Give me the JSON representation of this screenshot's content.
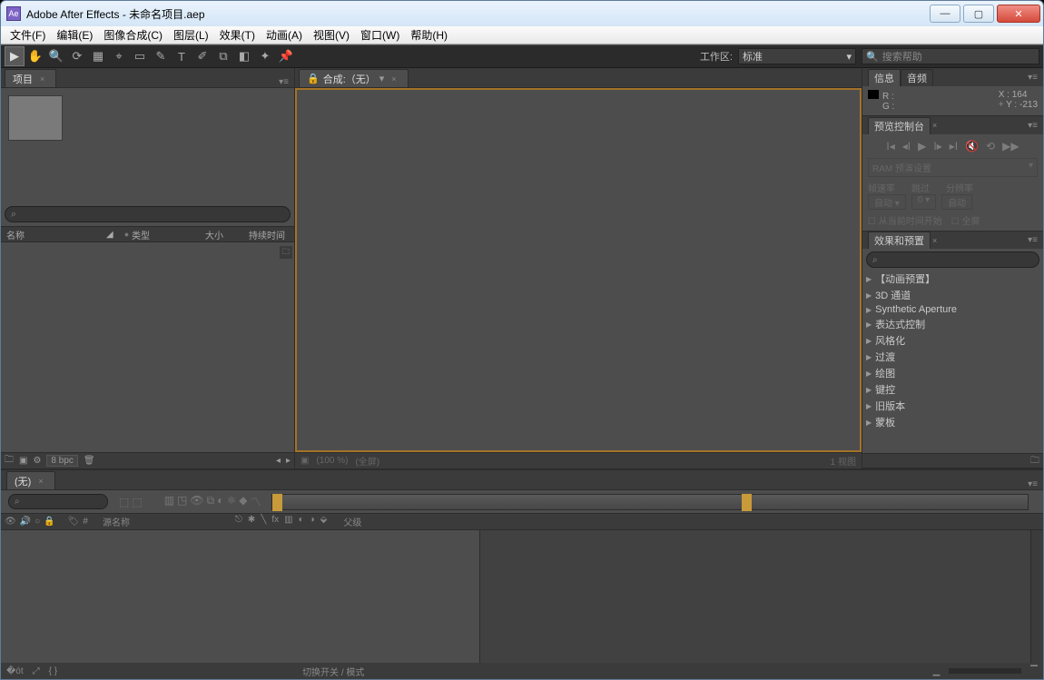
{
  "title": "Adobe After Effects - 未命名项目.aep",
  "menus": [
    "文件(F)",
    "编辑(E)",
    "图像合成(C)",
    "图层(L)",
    "效果(T)",
    "动画(A)",
    "视图(V)",
    "窗口(W)",
    "帮助(H)"
  ],
  "toolbar": {
    "workspace_label": "工作区:",
    "workspace_value": "标准",
    "search_placeholder": "搜索帮助"
  },
  "project": {
    "tab": "项目",
    "columns": {
      "name": "名称",
      "label_hdr": "",
      "type": "类型",
      "size": "大小",
      "duration": "持续时间"
    },
    "footer": {
      "bpc": "8 bpc"
    }
  },
  "composition": {
    "tab": "合成:（无）",
    "footer": {
      "zoom": "(100 %)",
      "res": "(全屏)",
      "view": "1 视图"
    }
  },
  "info": {
    "tab_info": "信息",
    "tab_audio": "音频",
    "r": "R :",
    "g": "G :",
    "x_lbl": "X :",
    "x_val": "164",
    "y_lbl": "Y :",
    "y_val": "-213"
  },
  "preview": {
    "title": "预览控制台",
    "ram": "RAM 预演设置",
    "rate": "帧速率",
    "skip": "跳过",
    "res": "分辨率",
    "auto": "自动",
    "from": "从当前时间开始",
    "full": "全屏"
  },
  "effects": {
    "title": "效果和预置",
    "items": [
      "【动画预置】",
      "3D 通道",
      "Synthetic Aperture",
      "表达式控制",
      "风格化",
      "过渡",
      "绘图",
      "键控",
      "旧版本",
      "蒙板"
    ]
  },
  "timeline": {
    "tab": "(无)",
    "name_col": "源名称",
    "parent": "父级",
    "mode": "切换开关 / 模式"
  }
}
